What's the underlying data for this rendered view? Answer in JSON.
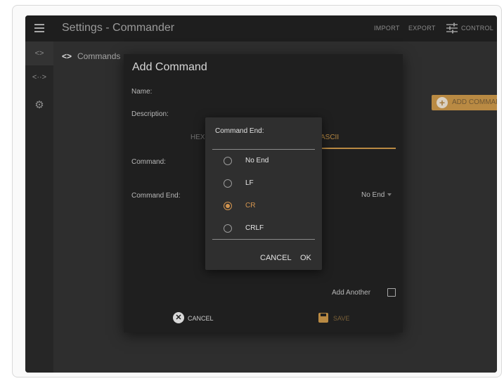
{
  "topbar": {
    "title": "Settings - Commander",
    "import_label": "IMPORT",
    "export_label": "EXPORT",
    "control_label": "CONTROL"
  },
  "rail": {
    "items": [
      {
        "icon": "code-icon",
        "glyph": "<>"
      },
      {
        "icon": "code-dots-icon",
        "glyph": "<··>"
      },
      {
        "icon": "gear-icon",
        "glyph": "⚙"
      }
    ]
  },
  "breadcrumb": {
    "icon": "<>",
    "label": "Commands"
  },
  "add_command_button": {
    "label": "ADD COMMAND",
    "color": "#b98a43"
  },
  "dialog": {
    "title": "Add Command",
    "name_label": "Name:",
    "description_label": "Description:",
    "tabs": [
      {
        "label": "HEX",
        "active": false
      },
      {
        "label": "ASCII",
        "active": true
      }
    ],
    "command_label": "Command:",
    "command_end_label": "Command End:",
    "command_end_value": "No End",
    "add_another_label": "Add Another",
    "add_another_checked": false,
    "cancel_label": "CANCEL",
    "save_label": "SAVE",
    "accent_color": "#b98a43"
  },
  "popup": {
    "title": "Command End:",
    "options": [
      {
        "label": "No End",
        "selected": false
      },
      {
        "label": "LF",
        "selected": false
      },
      {
        "label": "CR",
        "selected": true
      },
      {
        "label": "CRLF",
        "selected": false
      }
    ],
    "cancel_label": "CANCEL",
    "ok_label": "OK",
    "selected_color": "#d4954f"
  }
}
